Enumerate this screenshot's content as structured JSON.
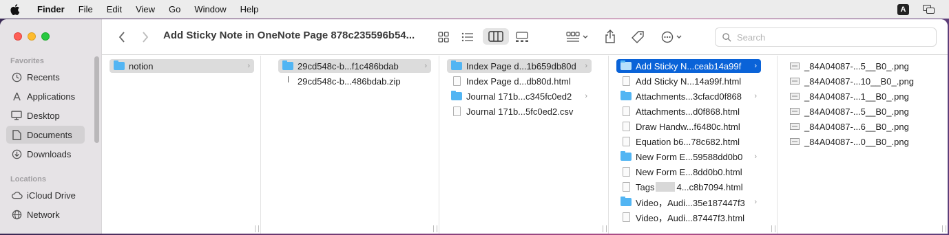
{
  "menubar": {
    "app": "Finder",
    "items": [
      "File",
      "Edit",
      "View",
      "Go",
      "Window",
      "Help"
    ],
    "input_indicator": "A"
  },
  "toolbar": {
    "title": "Add Sticky Note in OneNote Page 878c235596b54...",
    "search_placeholder": "Search"
  },
  "sidebar": {
    "favorites_label": "Favorites",
    "favorites": [
      "Recents",
      "Applications",
      "Desktop",
      "Documents",
      "Downloads"
    ],
    "selected": "Documents",
    "locations_label": "Locations",
    "locations": [
      "iCloud Drive",
      "Network"
    ]
  },
  "columns": [
    {
      "items": [
        {
          "name": "notion",
          "type": "folder",
          "state": "selected"
        }
      ]
    },
    {
      "items": [
        {
          "name": "29cd548c-b...f1c486bdab",
          "type": "folder",
          "state": "selected"
        },
        {
          "name": "29cd548c-b...486bdab.zip",
          "type": "zip"
        }
      ]
    },
    {
      "items": [
        {
          "name": "Index Page d...1b659db80d",
          "type": "folder",
          "state": "selected"
        },
        {
          "name": "Index Page d...db80d.html",
          "type": "doc"
        },
        {
          "name": "Journal 171b...c345fc0ed2",
          "type": "folder"
        },
        {
          "name": "Journal 171b...5fc0ed2.csv",
          "type": "doc"
        }
      ]
    },
    {
      "items": [
        {
          "name": "Add Sticky N...ceab14a99f",
          "type": "folder",
          "state": "active"
        },
        {
          "name": "Add Sticky N...14a99f.html",
          "type": "doc"
        },
        {
          "name": "Attachments...3cfacd0f868",
          "type": "folder"
        },
        {
          "name": "Attachments...d0f868.html",
          "type": "doc"
        },
        {
          "name": "Draw Handw...f6480c.html",
          "type": "doc"
        },
        {
          "name": "Equation b6...78c682.html",
          "type": "doc"
        },
        {
          "name": "New Form E...59588dd0b0",
          "type": "folder"
        },
        {
          "name": "New Form E...8dd0b0.html",
          "type": "doc"
        },
        {
          "name": "Tags",
          "suffix": "4...c8b7094.html",
          "type": "doc"
        },
        {
          "name": "Video，Audi...35e187447f3",
          "type": "folder"
        },
        {
          "name": "Video，Audi...87447f3.html",
          "type": "doc"
        }
      ]
    },
    {
      "items": [
        {
          "name": "_84A04087-...5__B0_.png",
          "type": "png"
        },
        {
          "name": "_84A04087-...10__B0_.png",
          "type": "png"
        },
        {
          "name": "_84A04087-...1__B0_.png",
          "type": "png"
        },
        {
          "name": "_84A04087-...5__B0_.png",
          "type": "png"
        },
        {
          "name": "_84A04087-...6__B0_.png",
          "type": "png"
        },
        {
          "name": "_84A04087-...0__B0_.png",
          "type": "png"
        }
      ]
    }
  ]
}
